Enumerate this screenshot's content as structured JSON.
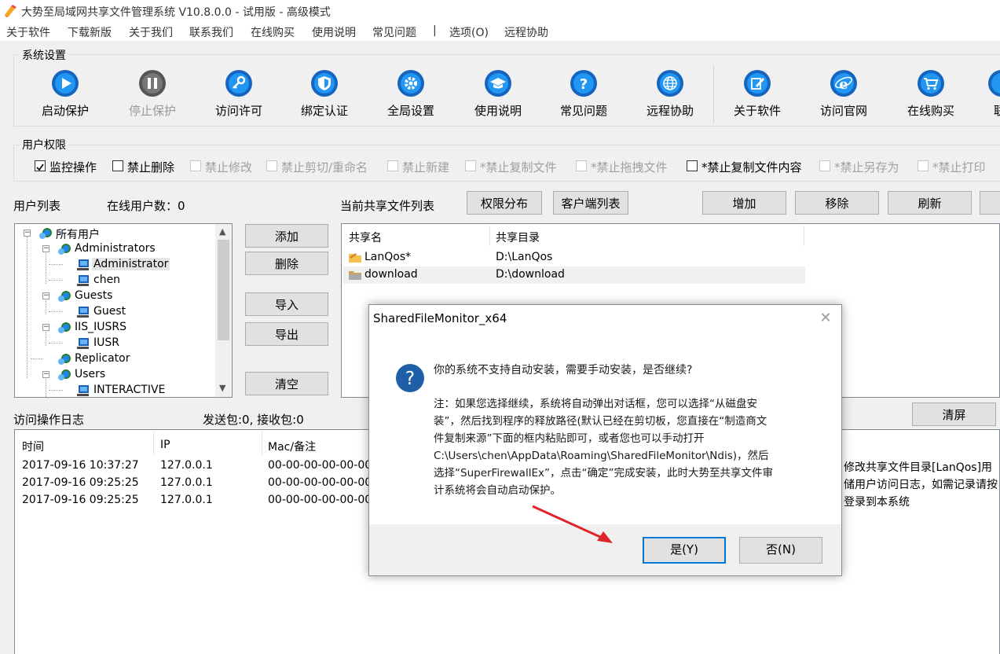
{
  "window": {
    "title": "大势至局域网共享文件管理系统 V10.8.0.0 - 试用版 - 高级模式"
  },
  "menu": [
    "关于软件",
    "下载新版",
    "关于我们",
    "联系我们",
    "在线购买",
    "使用说明",
    "常见问题",
    "|",
    "选项(O)",
    "远程协助"
  ],
  "system_settings": {
    "title": "系统设置",
    "tools": [
      {
        "label": "启动保护",
        "icon": "play-icon",
        "enabled": true
      },
      {
        "label": "停止保护",
        "icon": "pause-icon",
        "enabled": false
      },
      {
        "label": "访问许可",
        "icon": "key-icon",
        "enabled": true
      },
      {
        "label": "绑定认证",
        "icon": "shield-icon",
        "enabled": true
      },
      {
        "label": "全局设置",
        "icon": "gear-icon",
        "enabled": true
      },
      {
        "label": "使用说明",
        "icon": "graduation-cap-icon",
        "enabled": true
      },
      {
        "label": "常见问题",
        "icon": "question-icon",
        "enabled": true
      },
      {
        "label": "远程协助",
        "icon": "globe-icon",
        "enabled": true
      },
      {
        "label": "关于软件",
        "icon": "edit-icon",
        "enabled": true
      },
      {
        "label": "访问官网",
        "icon": "ie-browser-icon",
        "enabled": true
      },
      {
        "label": "在线购买",
        "icon": "cart-icon",
        "enabled": true
      },
      {
        "label": "联",
        "icon": "contact-icon",
        "enabled": true
      }
    ]
  },
  "permissions": {
    "title": "用户权限",
    "checkboxes": [
      {
        "label": "监控操作",
        "checked": true,
        "enabled": true
      },
      {
        "label": "禁止删除",
        "checked": false,
        "enabled": true
      },
      {
        "label": "禁止修改",
        "checked": false,
        "enabled": false
      },
      {
        "label": "禁止剪切/重命名",
        "checked": false,
        "enabled": false
      },
      {
        "label": "禁止新建",
        "checked": false,
        "enabled": false
      },
      {
        "label": "*禁止复制文件",
        "checked": false,
        "enabled": false
      },
      {
        "label": "*禁止拖拽文件",
        "checked": false,
        "enabled": false
      },
      {
        "label": "*禁止复制文件内容",
        "checked": false,
        "enabled": true
      },
      {
        "label": "*禁止另存为",
        "checked": false,
        "enabled": false
      },
      {
        "label": "*禁止打印",
        "checked": false,
        "enabled": false
      }
    ]
  },
  "users": {
    "label": "用户列表",
    "online_label": "在线用户数：0",
    "tree": [
      {
        "label": "所有用户",
        "level": 0,
        "icon": "network-users-icon"
      },
      {
        "label": "Administrators",
        "level": 1,
        "icon": "group-icon"
      },
      {
        "label": "Administrator",
        "level": 2,
        "icon": "computer-icon",
        "selected": true
      },
      {
        "label": "chen",
        "level": 2,
        "icon": "computer-icon"
      },
      {
        "label": "Guests",
        "level": 1,
        "icon": "group-icon"
      },
      {
        "label": "Guest",
        "level": 2,
        "icon": "computer-icon"
      },
      {
        "label": "IIS_IUSRS",
        "level": 1,
        "icon": "group-icon"
      },
      {
        "label": "IUSR",
        "level": 2,
        "icon": "computer-icon"
      },
      {
        "label": "Replicator",
        "level": 1,
        "icon": "group-icon"
      },
      {
        "label": "Users",
        "level": 1,
        "icon": "group-icon"
      },
      {
        "label": "INTERACTIVE",
        "level": 2,
        "icon": "computer-icon"
      }
    ],
    "buttons": [
      "添加",
      "删除",
      "导入",
      "导出",
      "清空"
    ]
  },
  "shares": {
    "label": "当前共享文件列表",
    "buttons": [
      "权限分布",
      "客户端列表",
      "增加",
      "移除",
      "刷新"
    ],
    "columns": [
      "共享名",
      "共享目录"
    ],
    "rows": [
      {
        "name": "LanQos*",
        "path": "D:\\LanQos"
      },
      {
        "name": "download",
        "path": "D:\\download"
      }
    ]
  },
  "log": {
    "label": "访问操作日志",
    "packets": "发送包:0, 接收包:0",
    "clear_button": "清屏",
    "columns": [
      "时间",
      "IP",
      "Mac/备注"
    ],
    "rows": [
      {
        "time": "2017-09-16 10:37:27",
        "ip": "127.0.0.1",
        "mac": "00-00-00-00-00-00",
        "note": "修改共享文件目录[LanQos]用"
      },
      {
        "time": "2017-09-16 09:25:25",
        "ip": "127.0.0.1",
        "mac": "00-00-00-00-00-00",
        "note": "储用户访问日志，如需记录请按"
      },
      {
        "time": "2017-09-16 09:25:25",
        "ip": "127.0.0.1",
        "mac": "00-00-00-00-00-00",
        "note": "登录到本系统"
      }
    ]
  },
  "dialog": {
    "title": "SharedFileMonitor_x64",
    "message": "你的系统不支持自动安装，需要手动安装，是否继续?",
    "detail": [
      "注：如果您选择继续，系统将自动弹出对话框，您可以选择“从磁盘安",
      "装”，然后找到程序的释放路径(默认已经在剪切板，您直接在“制造商文",
      "件复制来源”下面的框内粘贴即可，或者您也可以手动打开",
      "C:\\Users\\chen\\AppData\\Roaming\\SharedFileMonitor\\Ndis)，然后",
      "选择“SuperFirewallEx”，点击“确定”完成安装，此时大势至共享文件审",
      "计系统将会自动启动保护。"
    ],
    "yes_label": "是(Y)",
    "no_label": "否(N)"
  },
  "colors": {
    "accent": "#0078d7",
    "icon_blue": "#1565c0",
    "arrow_red": "#e0242a"
  }
}
